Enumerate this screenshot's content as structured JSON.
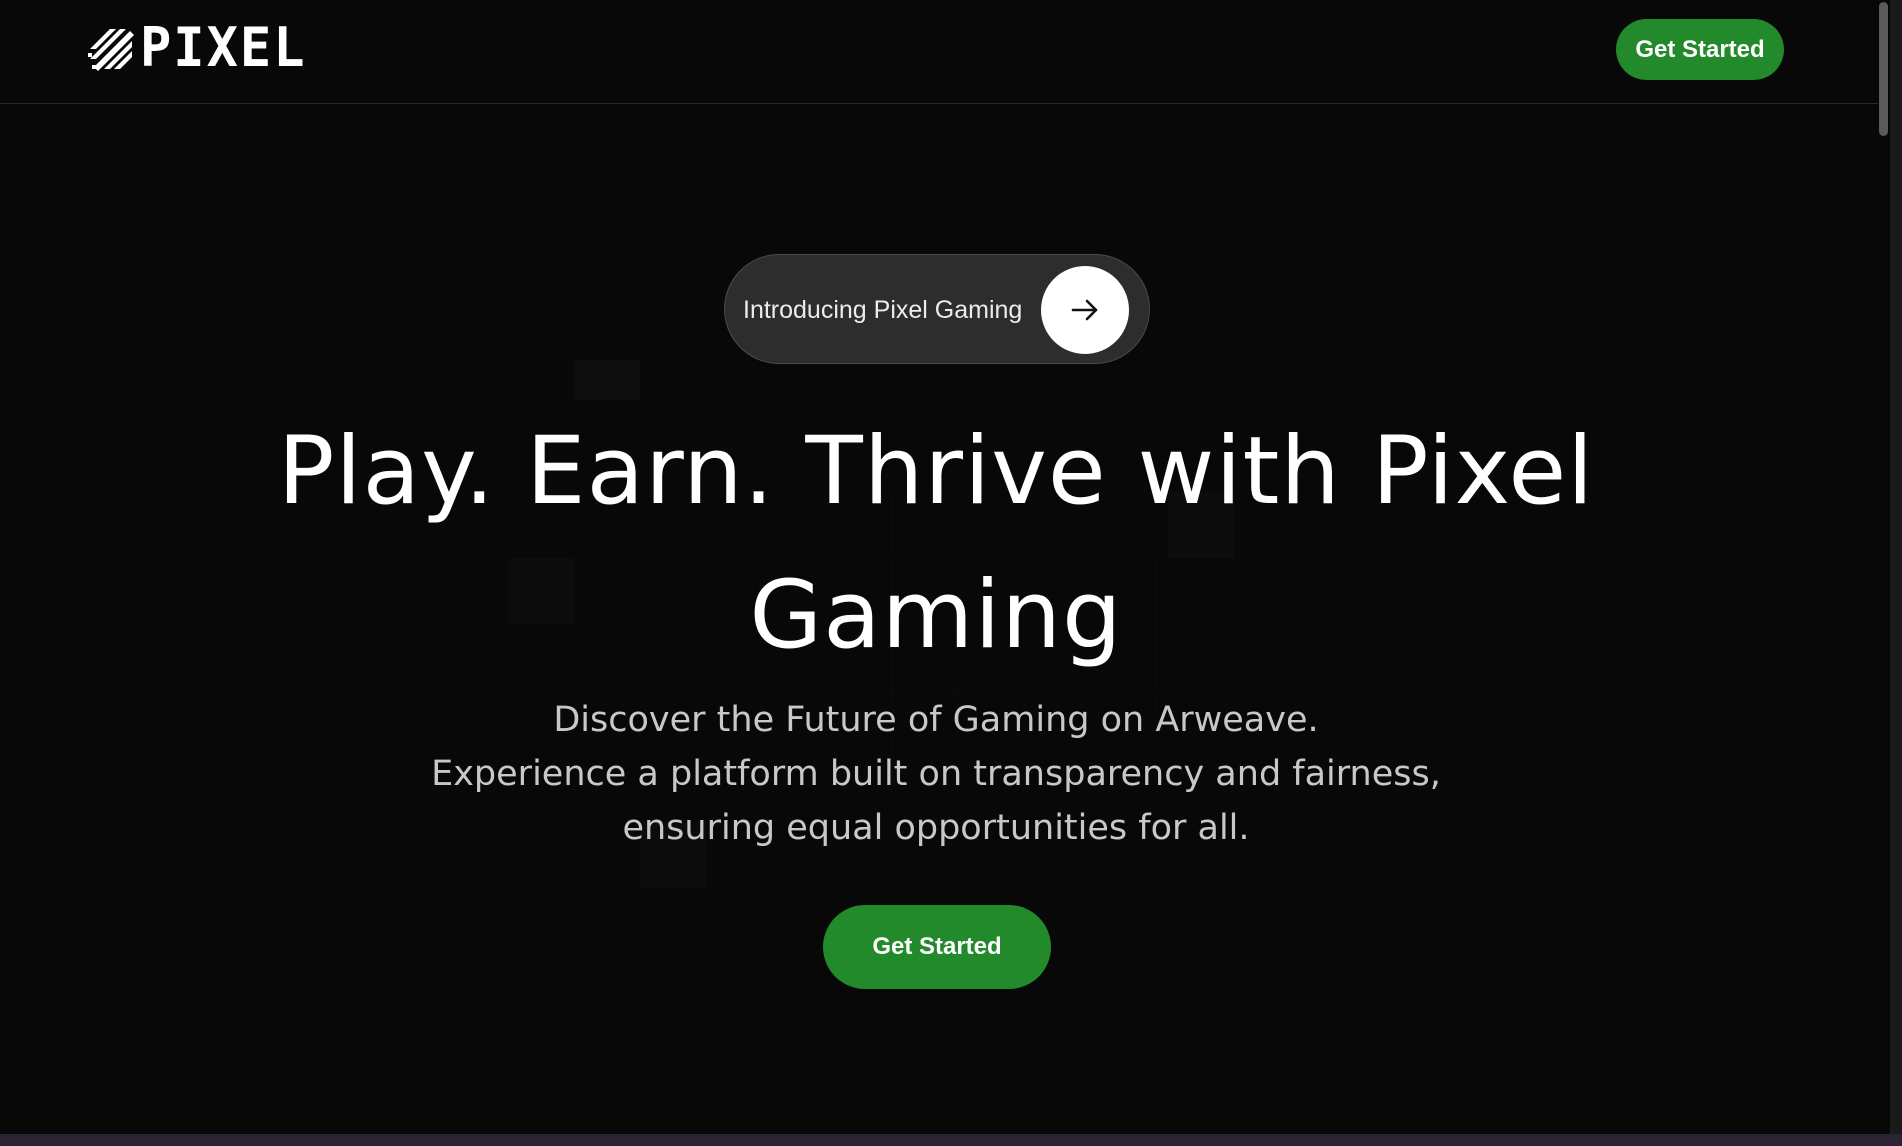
{
  "header": {
    "logo_text": "PIXEL",
    "cta_label": "Get Started"
  },
  "hero": {
    "pill_label": "Introducing Pixel Gaming",
    "headline_line1": "Play. Earn. Thrive with Pixel",
    "headline_line2": "Gaming",
    "subtext_line1": "Discover the Future of Gaming on Arweave.",
    "subtext_line2": "Experience a platform built on transparency and fairness,",
    "subtext_line3": "ensuring equal opportunities for all.",
    "cta_label": "Get Started"
  },
  "icons": {
    "logo": "slashes-logo-icon",
    "pill_arrow": "arrow-right-icon"
  },
  "colors": {
    "background": "#080808",
    "accent_green": "#238a2c",
    "text_primary": "#ffffff",
    "text_secondary": "#c8c8c8",
    "pill_background": "#2d2d2d"
  }
}
